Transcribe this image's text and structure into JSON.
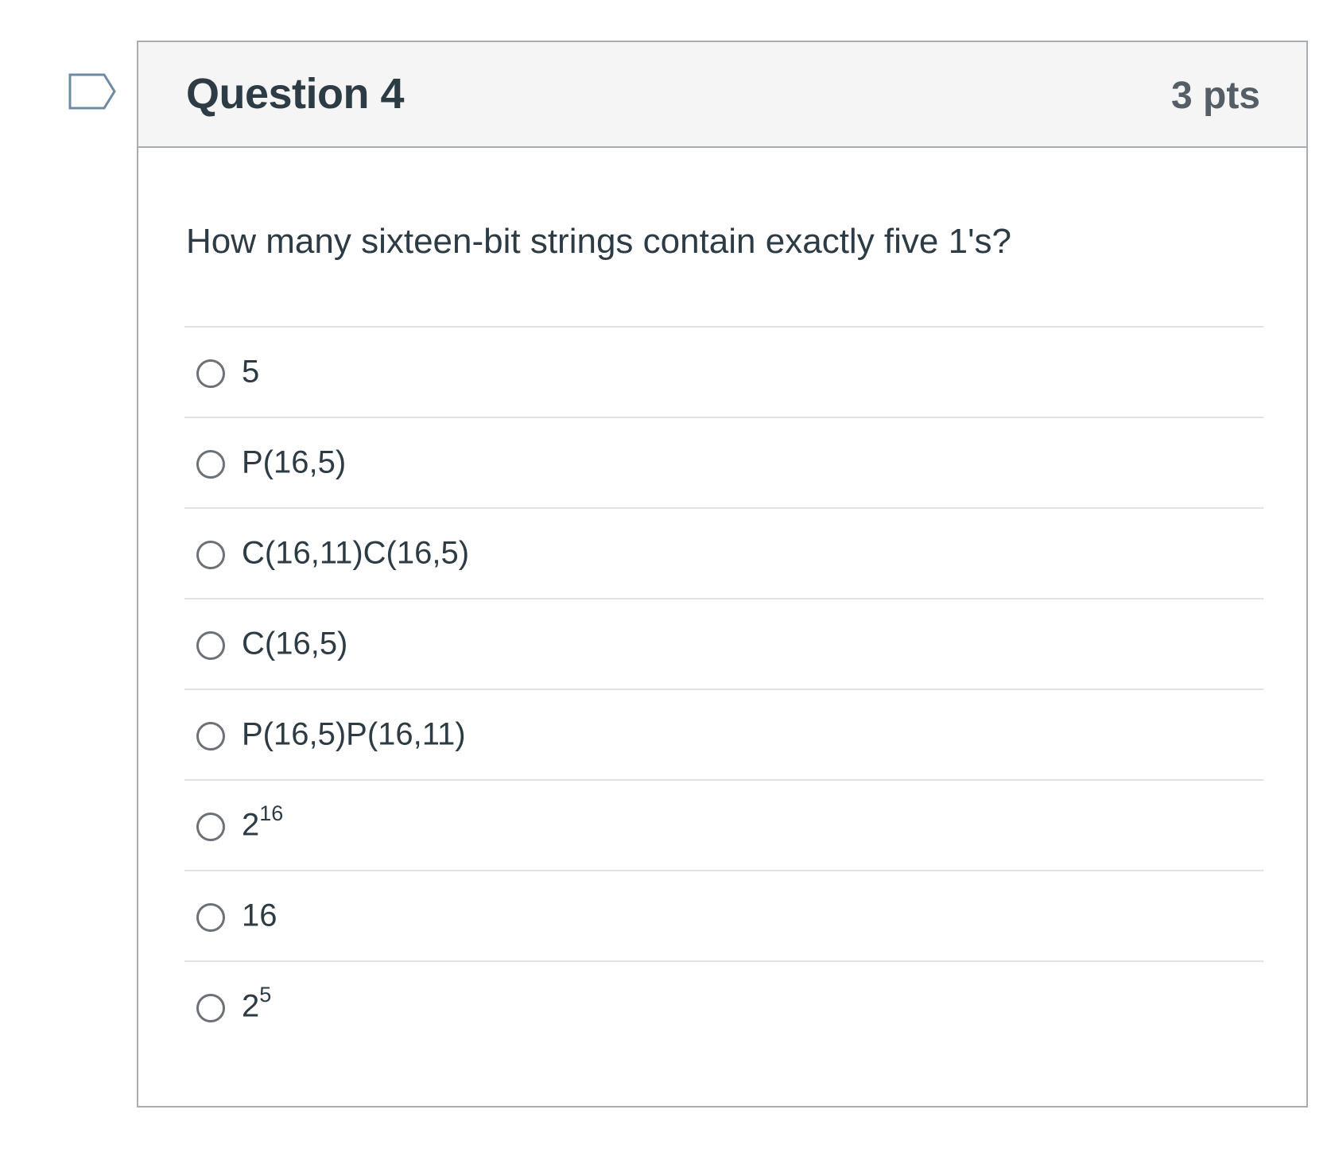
{
  "flag": {
    "icon": "bookmark-flag-icon"
  },
  "question": {
    "title": "Question 4",
    "points": "3 pts",
    "text": "How many sixteen-bit strings contain exactly five 1's?"
  },
  "answers": [
    {
      "base": "5",
      "sup": ""
    },
    {
      "base": "P(16,5)",
      "sup": ""
    },
    {
      "base": "C(16,11)C(16,5)",
      "sup": ""
    },
    {
      "base": "C(16,5)",
      "sup": ""
    },
    {
      "base": "P(16,5)P(16,11)",
      "sup": ""
    },
    {
      "base": "2",
      "sup": "16"
    },
    {
      "base": "16",
      "sup": ""
    },
    {
      "base": "2",
      "sup": "5"
    }
  ],
  "colors": {
    "header_bg": "#f5f5f5",
    "border": "#a9adb2",
    "text": "#2d3b45",
    "flag_stroke": "#6e8ba3"
  }
}
